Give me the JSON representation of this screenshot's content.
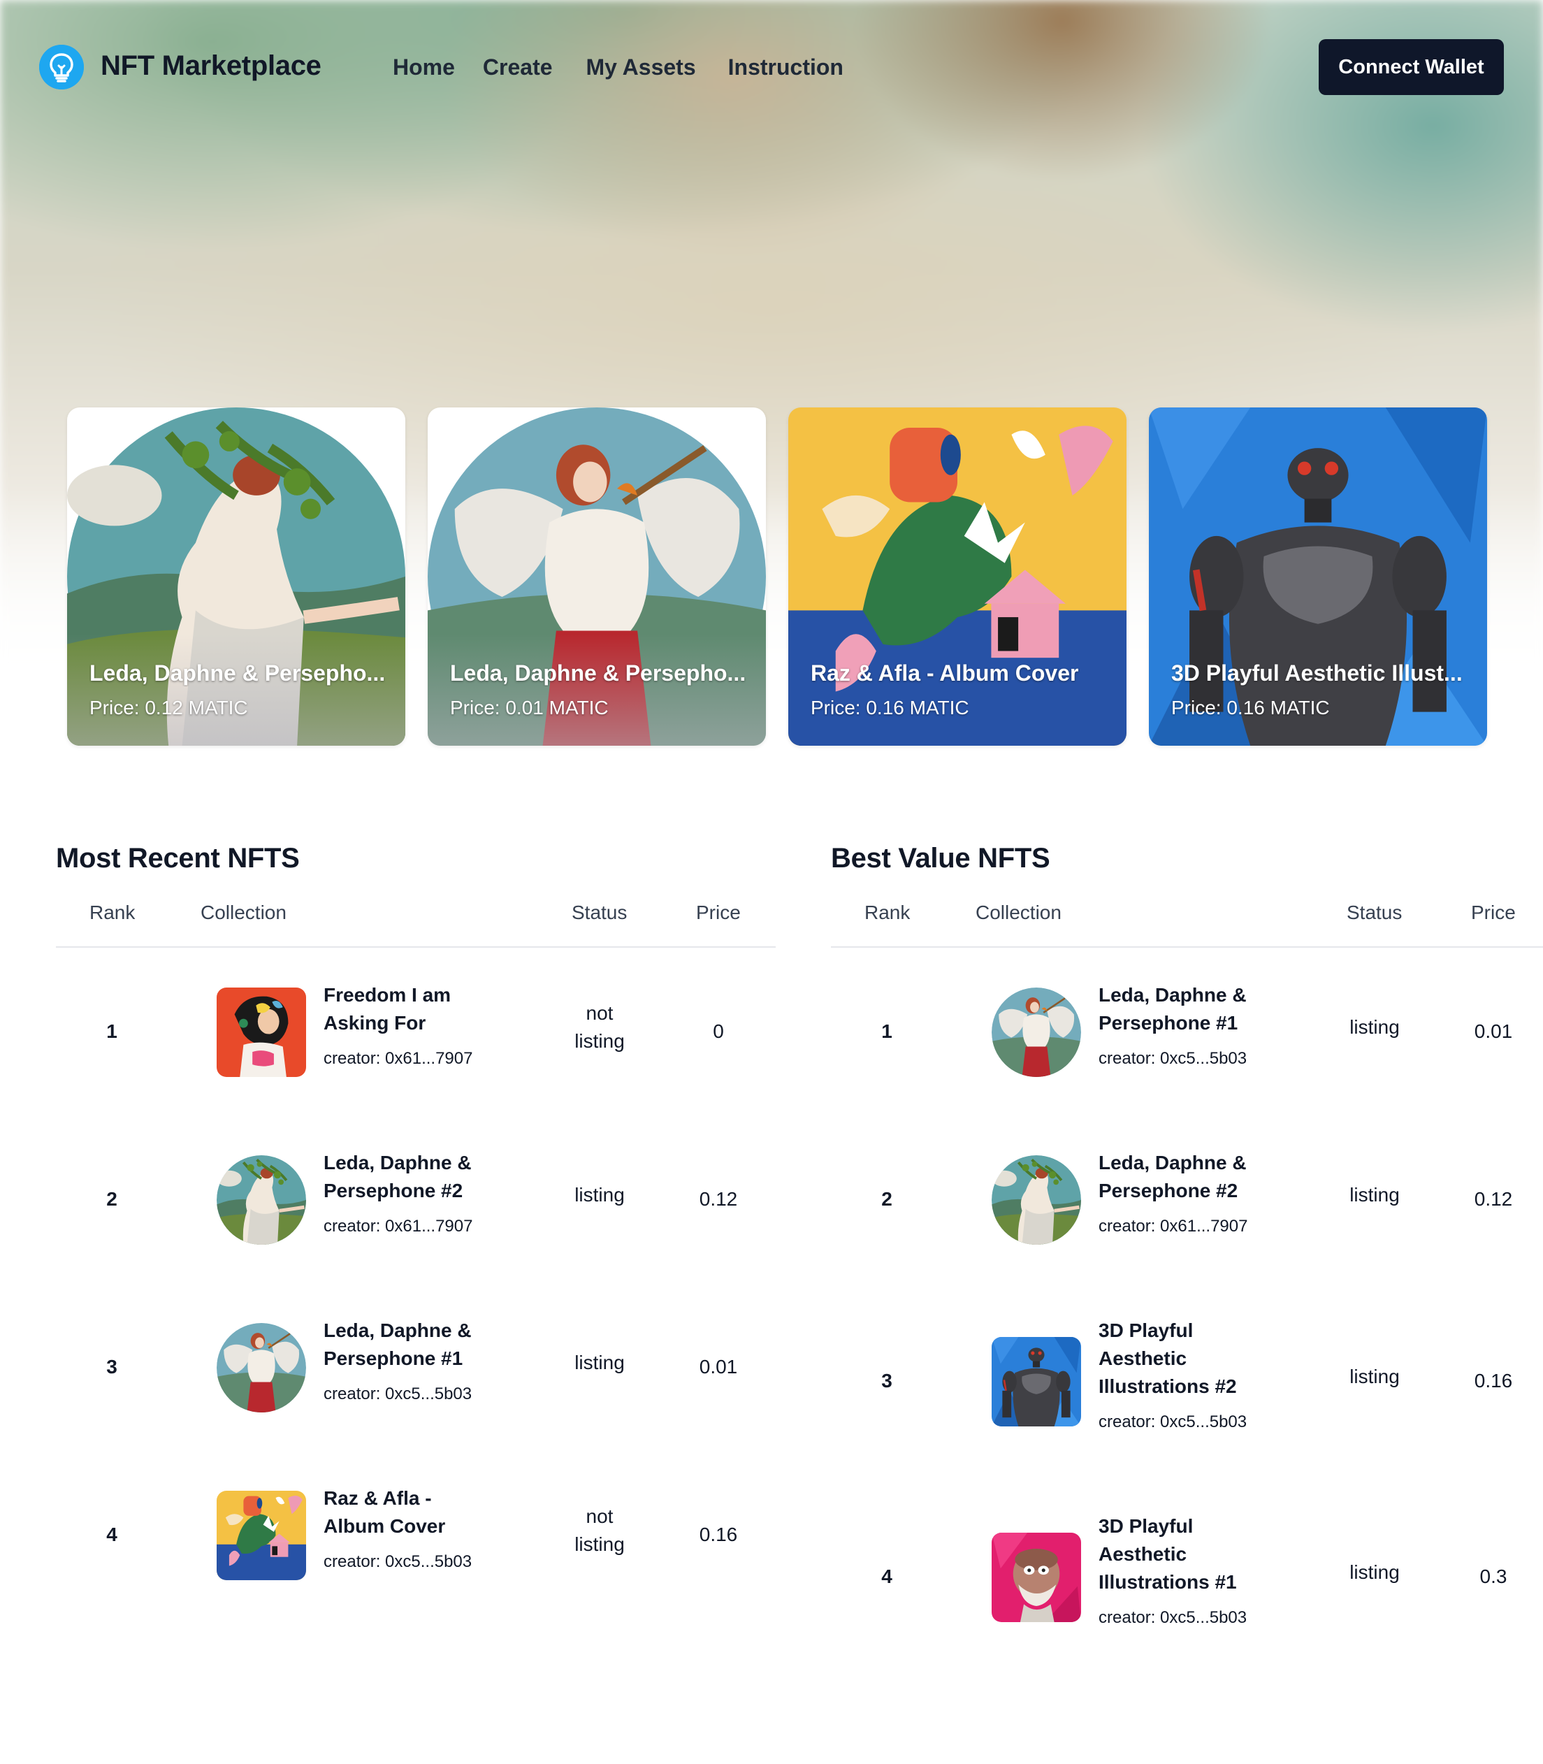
{
  "app": {
    "brand": "NFT Marketplace",
    "nav": [
      "Home",
      "Create",
      "My Assets",
      "Instruction"
    ],
    "connect_label": "Connect Wallet"
  },
  "featured": [
    {
      "title": "Leda, Daphne & Persepho...",
      "price": "Price: 0.12 MATIC",
      "art": "leda-daphne-2"
    },
    {
      "title": "Leda, Daphne & Persepho...",
      "price": "Price: 0.01 MATIC",
      "art": "leda-daphne-1"
    },
    {
      "title": "Raz & Afla - Album Cover",
      "price": "Price: 0.16 MATIC",
      "art": "raz-afla"
    },
    {
      "title": "3D Playful Aesthetic Illust...",
      "price": "Price: 0.16 MATIC",
      "art": "robot"
    }
  ],
  "recent": {
    "title": "Most Recent NFTS",
    "columns": [
      "Rank",
      "Collection",
      "Status",
      "Price"
    ],
    "rows": [
      {
        "rank": "1",
        "name_l1": "Freedom I am",
        "name_l2": "Asking For",
        "name_l3": "",
        "creator": "creator: 0x61...7907",
        "status_l1": "not",
        "status_l2": "listing",
        "price": "0",
        "art": "freedom"
      },
      {
        "rank": "2",
        "name_l1": "Leda, Daphne &",
        "name_l2": "Persephone #2",
        "name_l3": "",
        "creator": "creator: 0x61...7907",
        "status_l1": "listing",
        "status_l2": "",
        "price": "0.12",
        "art": "leda-daphne-2"
      },
      {
        "rank": "3",
        "name_l1": "Leda, Daphne &",
        "name_l2": "Persephone #1",
        "name_l3": "",
        "creator": "creator: 0xc5...5b03",
        "status_l1": "listing",
        "status_l2": "",
        "price": "0.01",
        "art": "leda-daphne-1"
      },
      {
        "rank": "4",
        "name_l1": "Raz & Afla -",
        "name_l2": "Album Cover",
        "name_l3": "",
        "creator": "creator: 0xc5...5b03",
        "status_l1": "not",
        "status_l2": "listing",
        "price": "0.16",
        "art": "raz-afla"
      }
    ]
  },
  "best": {
    "title": "Best Value NFTS",
    "columns": [
      "Rank",
      "Collection",
      "Status",
      "Price"
    ],
    "rows": [
      {
        "rank": "1",
        "name_l1": "Leda, Daphne &",
        "name_l2": "Persephone #1",
        "name_l3": "",
        "creator": "creator: 0xc5...5b03",
        "status_l1": "listing",
        "status_l2": "",
        "price": "0.01",
        "art": "leda-daphne-1"
      },
      {
        "rank": "2",
        "name_l1": "Leda, Daphne &",
        "name_l2": "Persephone #2",
        "name_l3": "",
        "creator": "creator: 0x61...7907",
        "status_l1": "listing",
        "status_l2": "",
        "price": "0.12",
        "art": "leda-daphne-2"
      },
      {
        "rank": "3",
        "name_l1": "3D Playful",
        "name_l2": "Aesthetic",
        "name_l3": "Illustrations #2",
        "creator": "creator: 0xc5...5b03",
        "status_l1": "listing",
        "status_l2": "",
        "price": "0.16",
        "art": "robot"
      },
      {
        "rank": "4",
        "name_l1": "3D Playful",
        "name_l2": "Aesthetic",
        "name_l3": "Illustrations #1",
        "creator": "creator: 0xc5...5b03",
        "status_l1": "listing",
        "status_l2": "",
        "price": "0.3",
        "art": "pink-figure"
      }
    ]
  },
  "colors": {
    "primary_button": "#0f172a",
    "logo_blue": "#1ea7f0",
    "divider": "#e5e7eb"
  }
}
